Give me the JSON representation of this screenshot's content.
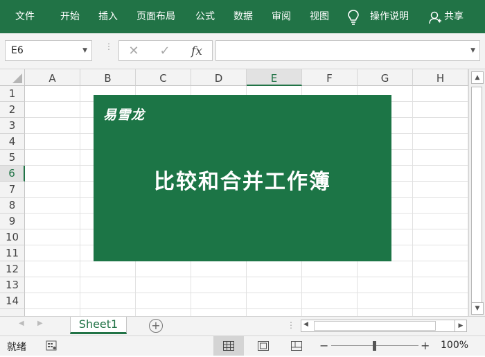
{
  "ribbon": {
    "tabs": [
      "文件",
      "开始",
      "插入",
      "页面布局",
      "公式",
      "数据",
      "审阅",
      "视图"
    ],
    "tell_me": "操作说明",
    "share": "共享"
  },
  "formula_bar": {
    "name_box": "E6",
    "cancel_glyph": "✕",
    "enter_glyph": "✓",
    "fx_label": "fx",
    "formula_value": ""
  },
  "grid": {
    "columns": [
      "A",
      "B",
      "C",
      "D",
      "E",
      "F",
      "G",
      "H"
    ],
    "rows": [
      "1",
      "2",
      "3",
      "4",
      "5",
      "6",
      "7",
      "8",
      "9",
      "10",
      "11",
      "12",
      "13",
      "14"
    ]
  },
  "banner": {
    "logo_text": "易雪龙",
    "title": "比较和合并工作簿",
    "background_color": "#1c7546"
  },
  "sheets": {
    "active": "Sheet1",
    "add_glyph": "+"
  },
  "status_bar": {
    "status_text": "就绪",
    "zoom": "100%",
    "zoom_minus": "−",
    "zoom_plus": "+"
  },
  "colors": {
    "accent": "#217346"
  }
}
